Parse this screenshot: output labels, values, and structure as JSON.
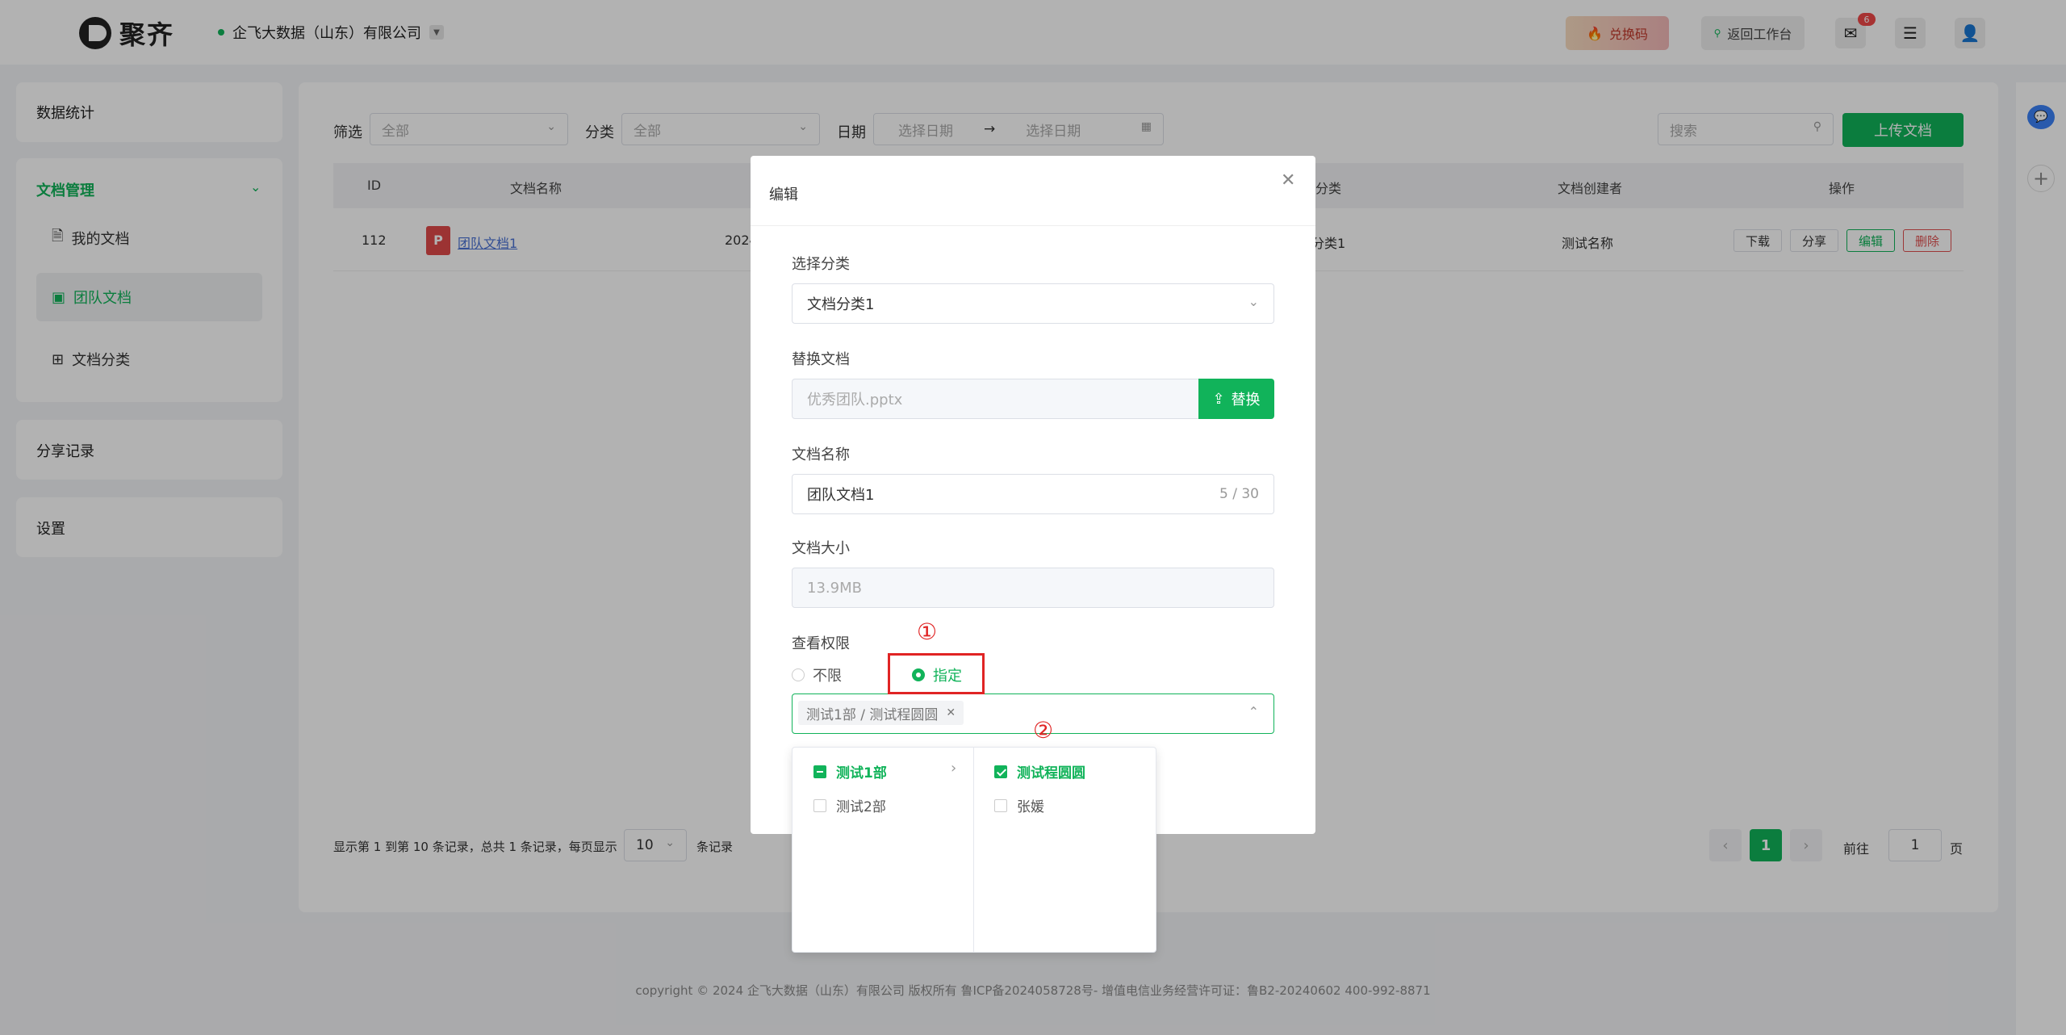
{
  "header": {
    "logo_text": "聚齐",
    "company": "企飞大数据（山东）有限公司",
    "redeem_label": "兑换码",
    "back_label": "返回工作台",
    "mail_badge": "6"
  },
  "sidebar": {
    "stats": "数据统计",
    "doc_manage": "文档管理",
    "my_docs": "我的文档",
    "team_docs": "团队文档",
    "doc_category": "文档分类",
    "share_records": "分享记录",
    "settings": "设置"
  },
  "filters": {
    "filter_label": "筛选",
    "filter_value": "全部",
    "category_label": "分类",
    "category_value": "全部",
    "date_label": "日期",
    "date_start": "选择日期",
    "date_arrow": "→",
    "date_end": "选择日期",
    "search_placeholder": "搜索",
    "upload_label": "上传文档"
  },
  "table": {
    "headers": [
      "ID",
      "文档名称",
      "分类",
      "文档创建者",
      "操作"
    ],
    "row": {
      "id": "112",
      "name": "团队文档1",
      "date_partial": "2024",
      "category_partial": "分类1",
      "creator": "测试名称",
      "actions": [
        "下载",
        "分享",
        "编辑",
        "删除"
      ]
    }
  },
  "pagination": {
    "summary_prefix": "显示第 1 到第 10 条记录，总共 1 条记录，每页显示",
    "page_size": "10",
    "summary_suffix": "条记录",
    "current_page": "1",
    "goto_label": "前往",
    "goto_value": "1",
    "page_unit": "页"
  },
  "footer": {
    "text": "copyright © 2024 企飞大数据（山东）有限公司 版权所有   鲁ICP备2024058728号-   增值电信业务经营许可证：鲁B2-20240602  400-992-8871"
  },
  "modal": {
    "title": "编辑",
    "category_label": "选择分类",
    "category_value": "文档分类1",
    "replace_label": "替换文档",
    "replace_file": "优秀团队.pptx",
    "replace_btn": "替换",
    "name_label": "文档名称",
    "name_value": "团队文档1",
    "name_count": "5 / 30",
    "size_label": "文档大小",
    "size_value": "13.9MB",
    "permission_label": "查看权限",
    "radio_unlimited": "不限",
    "radio_specified": "指定",
    "selected_tag": "测试1部 / 测试程圆圆",
    "mark_1": "①",
    "mark_2": "②"
  },
  "cascader": {
    "col1": [
      "测试1部",
      "测试2部"
    ],
    "col2": [
      "测试程圆圆",
      "张媛"
    ]
  },
  "colors": {
    "accent": "#11b35a",
    "highlight": "#e02424"
  }
}
